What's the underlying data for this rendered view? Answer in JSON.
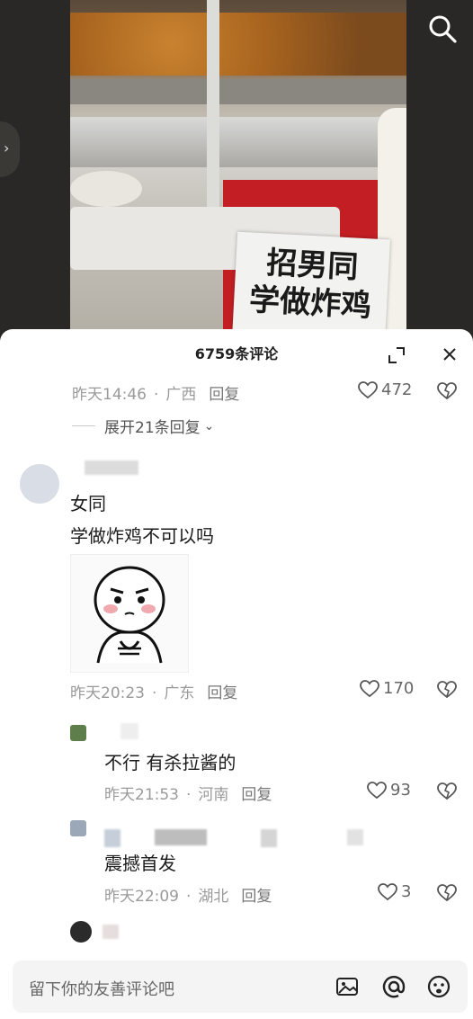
{
  "video": {
    "sign_line1": "招男同",
    "sign_line2": "学做炸鸡"
  },
  "comments_panel": {
    "title": "6759条评论",
    "first_comment_meta": {
      "time": "昨天14:46",
      "location": "广西",
      "reply_label": "回复",
      "likes": "472"
    },
    "expand_replies_label": "展开21条回复"
  },
  "comments": [
    {
      "text_lines": [
        "女同",
        "学做炸鸡不可以吗"
      ],
      "time": "昨天20:23",
      "location": "广东",
      "reply_label": "回复",
      "likes": "170"
    },
    {
      "text": "不行 有杀拉酱的",
      "time": "昨天21:53",
      "location": "河南",
      "reply_label": "回复",
      "likes": "93"
    },
    {
      "text": "震撼首发",
      "time": "昨天22:09",
      "location": "湖北",
      "reply_label": "回复",
      "likes": "3"
    }
  ],
  "input_bar": {
    "placeholder": "留下你的友善评论吧"
  },
  "colors": {
    "banner_red": "#c21e23",
    "meta_gray": "#9a9a9a"
  }
}
